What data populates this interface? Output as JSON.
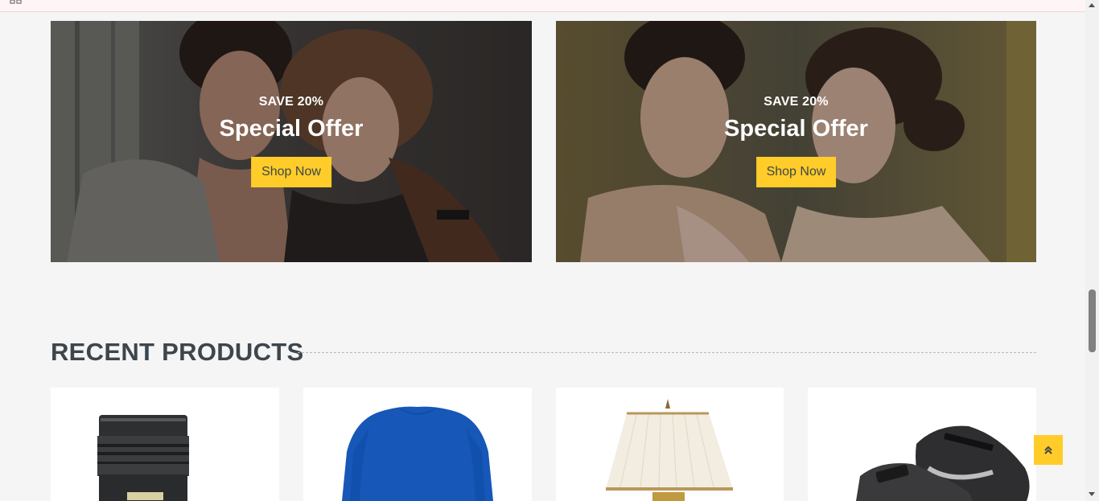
{
  "banners": [
    {
      "subtitle": "SAVE 20%",
      "title": "Special Offer",
      "button_label": "Shop Now"
    },
    {
      "subtitle": "SAVE 20%",
      "title": "Special Offer",
      "button_label": "Shop Now"
    }
  ],
  "recent_products": {
    "title": "RECENT PRODUCTS",
    "items": [
      {
        "image": "camera-lens"
      },
      {
        "image": "blue-sweater"
      },
      {
        "image": "table-lamp"
      },
      {
        "image": "nike-sneakers"
      }
    ]
  },
  "colors": {
    "accent": "#ffcc29",
    "text": "#3d464d",
    "background": "#f5f5f5"
  },
  "icons": {
    "back_to_top": "double-chevron-up-icon"
  }
}
